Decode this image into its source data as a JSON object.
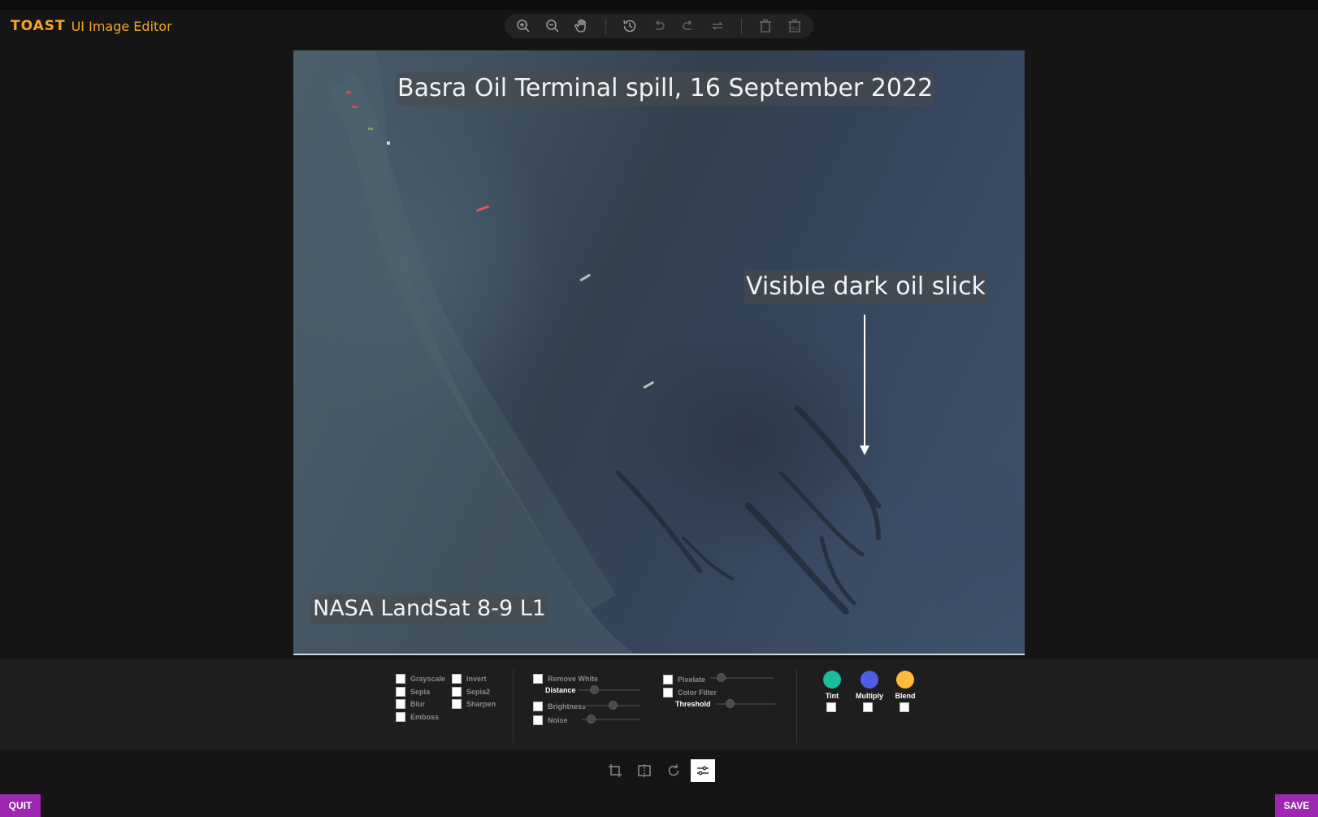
{
  "app": {
    "brand": "TOAST",
    "product": "UI Image Editor"
  },
  "menu": {
    "icons": [
      "zoom-in-icon",
      "zoom-out-icon",
      "hand-icon",
      "history-icon",
      "undo-icon",
      "redo-icon",
      "reset-icon",
      "delete-icon",
      "delete-all-icon"
    ]
  },
  "canvas": {
    "title_caption": "Basra Oil Terminal spill, 16 September 2022",
    "slick_caption": "Visible dark oil slick",
    "source_caption": "NASA LandSat 8-9 L1"
  },
  "filters": {
    "col1": [
      "Grayscale",
      "Sepia",
      "Blur",
      "Emboss"
    ],
    "col2": [
      "Invert",
      "Sepia2",
      "Sharpen"
    ],
    "remove_white": "Remove White",
    "distance": "Distance",
    "brightness": "Brightness",
    "noise": "Noise",
    "pixelate": "Pixelate",
    "color_filter": "Color Filter",
    "threshold": "Threshold",
    "tint": {
      "label": "Tint",
      "color": "#1abc9c"
    },
    "multiply": {
      "label": "Multiply",
      "color": "#515ce6"
    },
    "blend": {
      "label": "Blend",
      "color": "#ffbb3b"
    }
  },
  "tools": {
    "items": [
      "crop-icon",
      "flip-icon",
      "rotate-icon",
      "filter-icon"
    ],
    "active": "filter-icon"
  },
  "buttons": {
    "quit": "QUIT",
    "save": "SAVE"
  },
  "colors": {
    "accent": "#9c27b0",
    "logo": "#f5a623"
  }
}
